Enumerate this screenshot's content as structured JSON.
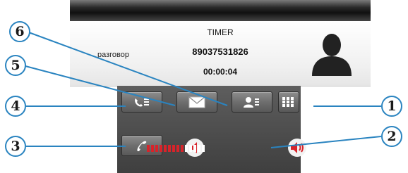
{
  "call": {
    "name": "TIMER",
    "number": "89037531826",
    "timer": "00:00:04",
    "status": "разговор"
  },
  "icons": {
    "avatar": "person-silhouette",
    "call_log": "phone-list-icon",
    "message": "envelope-icon",
    "contacts": "contact-card-icon",
    "keypad": "keypad-grid-icon",
    "end_call": "handset-icon",
    "volume_down": "speaker-quiet-icon",
    "volume_up": "speaker-loud-icon"
  },
  "volume": {
    "level": 0.65
  },
  "callouts": [
    "1",
    "2",
    "3",
    "4",
    "5",
    "6"
  ],
  "colors": {
    "callout_border": "#2a84c0",
    "volume_red": "#d8232a",
    "panel": "#4f4f4f"
  }
}
